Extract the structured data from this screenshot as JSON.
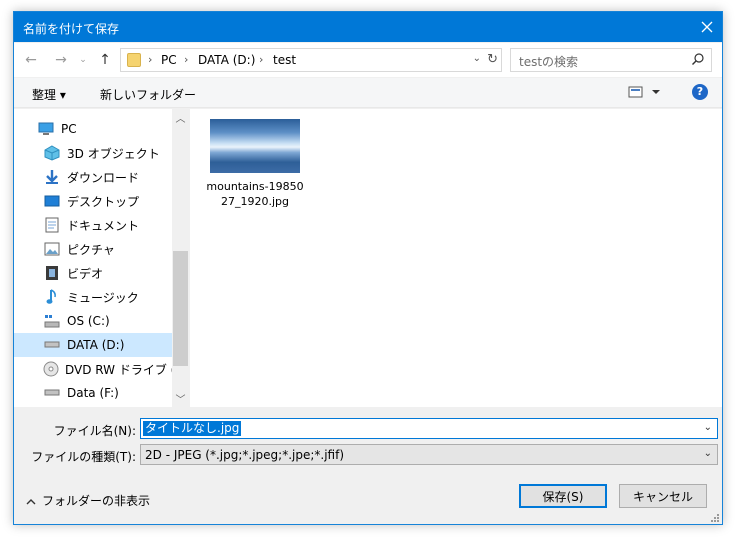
{
  "window": {
    "title": "名前を付けて保存"
  },
  "address": {
    "crumbs": [
      "PC",
      "DATA (D:)",
      "test"
    ]
  },
  "search": {
    "placeholder": "testの検索"
  },
  "toolbar": {
    "organize_label": "整理 ▾",
    "new_folder_label": "新しいフォルダー"
  },
  "tree": {
    "items": [
      {
        "label": "PC",
        "icon": "pc-icon"
      },
      {
        "label": "3D オブジェクト",
        "icon": "3d-objects-icon"
      },
      {
        "label": "ダウンロード",
        "icon": "download-icon"
      },
      {
        "label": "デスクトップ",
        "icon": "desktop-icon"
      },
      {
        "label": "ドキュメント",
        "icon": "document-icon"
      },
      {
        "label": "ピクチャ",
        "icon": "pictures-icon"
      },
      {
        "label": "ビデオ",
        "icon": "video-icon"
      },
      {
        "label": "ミュージック",
        "icon": "music-icon"
      },
      {
        "label": "OS (C:)",
        "icon": "os-drive-icon"
      },
      {
        "label": "DATA (D:)",
        "icon": "drive-icon",
        "selected": true
      },
      {
        "label": "DVD RW ドライブ (E:)",
        "icon": "dvd-icon"
      },
      {
        "label": "Data (F:)",
        "icon": "drive-icon"
      }
    ]
  },
  "files": [
    {
      "name": "mountains-1985027_1920.jpg"
    }
  ],
  "form": {
    "filename_label": "ファイル名(N):",
    "filename_value": "タイトルなし.jpg",
    "filetype_label": "ファイルの種類(T):",
    "filetype_value": "2D - JPEG (*.jpg;*.jpeg;*.jpe;*.jfif)"
  },
  "footer": {
    "hide_folders_label": "フォルダーの非表示",
    "save_label": "保存(S)",
    "cancel_label": "キャンセル"
  },
  "colors": {
    "accent": "#0078d7",
    "selection": "#cce8ff"
  }
}
